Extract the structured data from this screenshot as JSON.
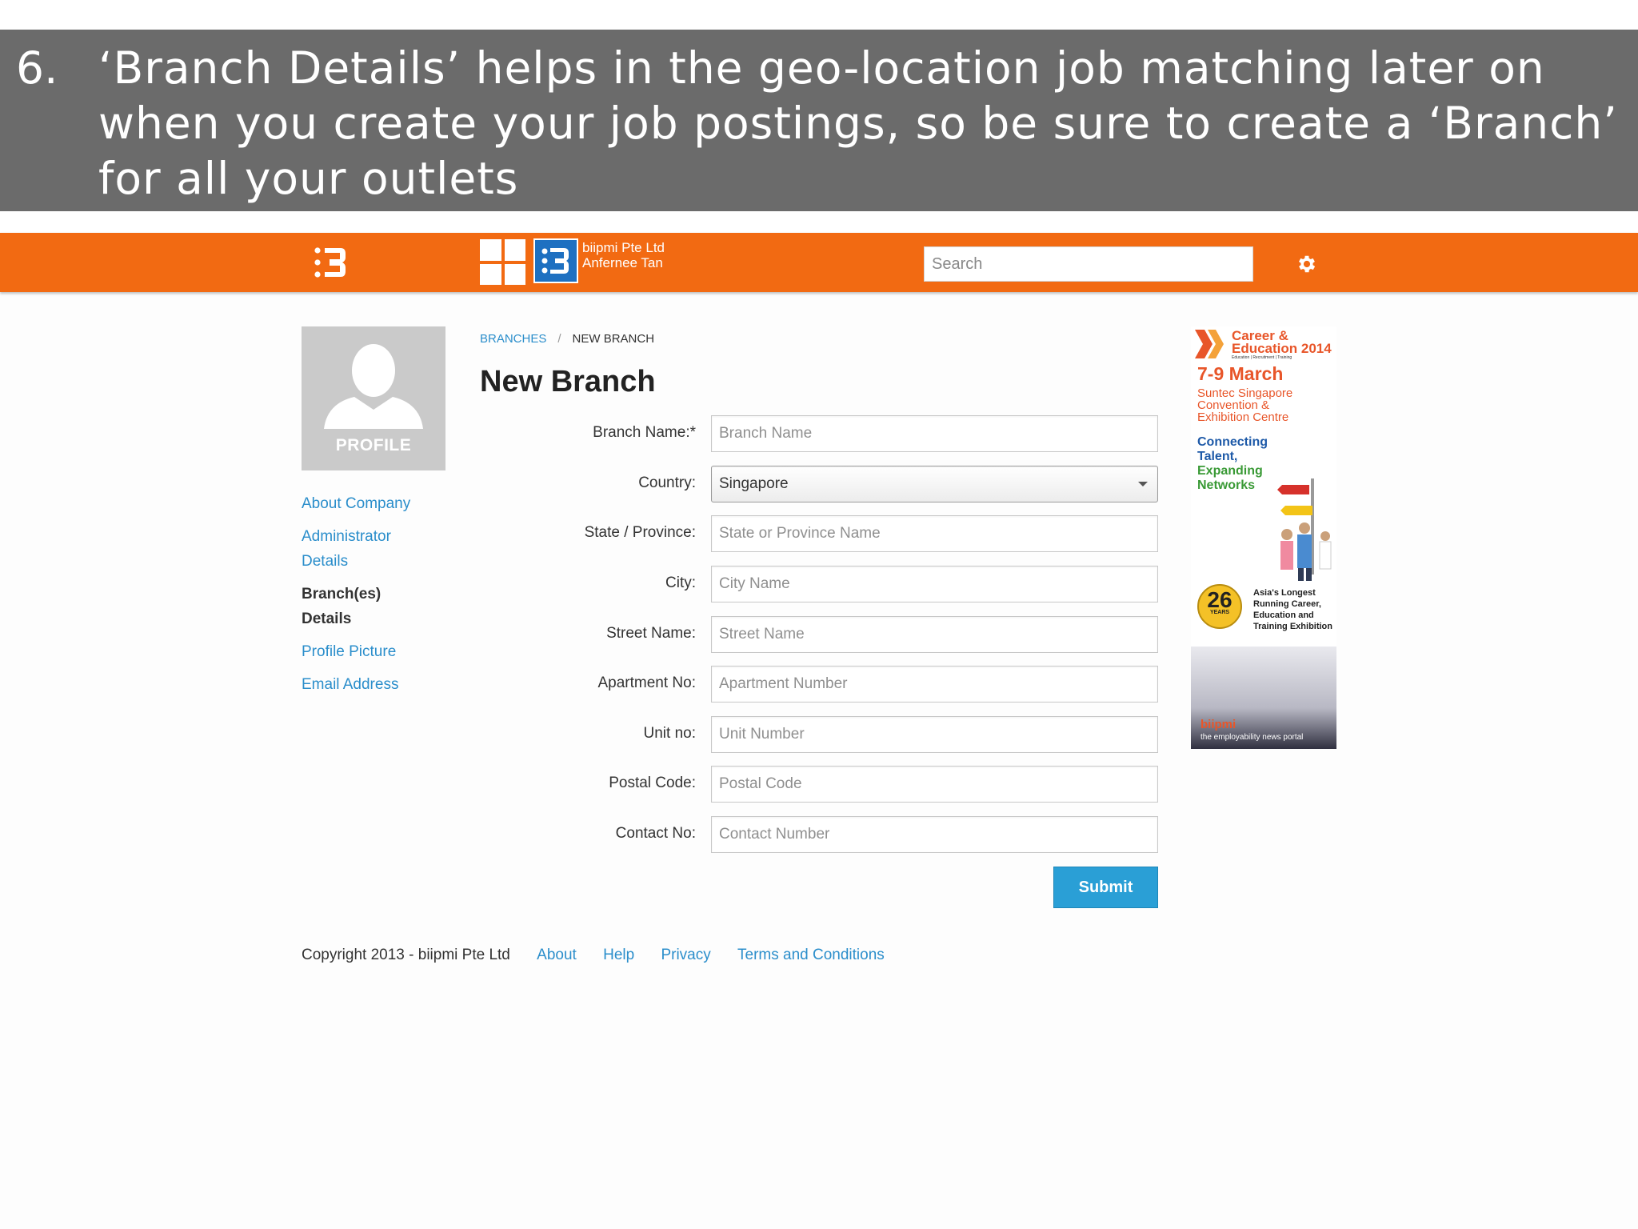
{
  "slide": {
    "number": "6.",
    "text": "‘Branch Details’ helps in the geo-location job matching later on when you create your job postings, so be sure to create a ‘Branch’ for all your outlets"
  },
  "header": {
    "company": "biipmi Pte Ltd",
    "user": "Anfernee Tan",
    "search_placeholder": "Search",
    "brand_color": "#f26a12"
  },
  "profile": {
    "label": "PROFILE"
  },
  "sidebar": {
    "items": [
      {
        "label": "About Company",
        "active": false
      },
      {
        "label": "Administrator Details",
        "active": false
      },
      {
        "label": "Branch(es) Details",
        "active": true
      },
      {
        "label": "Profile Picture",
        "active": false
      },
      {
        "label": "Email Address",
        "active": false
      }
    ]
  },
  "breadcrumb": {
    "parent": "BRANCHES",
    "separator": "/",
    "current": "NEW BRANCH"
  },
  "page_title": "New Branch",
  "form": {
    "branch_name": {
      "label": "Branch Name:*",
      "placeholder": "Branch Name"
    },
    "country": {
      "label": "Country:",
      "value": "Singapore"
    },
    "state": {
      "label": "State / Province:",
      "placeholder": "State or Province Name"
    },
    "city": {
      "label": "City:",
      "placeholder": "City Name"
    },
    "street": {
      "label": "Street Name:",
      "placeholder": "Street Name"
    },
    "apartment": {
      "label": "Apartment No:",
      "placeholder": "Apartment Number"
    },
    "unit": {
      "label": "Unit no:",
      "placeholder": "Unit Number"
    },
    "postal": {
      "label": "Postal Code:",
      "placeholder": "Postal Code"
    },
    "contact": {
      "label": "Contact No:",
      "placeholder": "Contact Number"
    },
    "submit_label": "Submit"
  },
  "footer": {
    "copyright": "Copyright 2013 - biipmi Pte Ltd",
    "links": [
      "About",
      "Help",
      "Privacy",
      "Terms and Conditions"
    ]
  },
  "ad": {
    "title_line1": "Career &",
    "title_line2": "Education 2014",
    "subtitle": "Education | Recruitment | Training",
    "date": "7-9 March",
    "venue_line1": "Suntec Singapore",
    "venue_line2": "Convention &",
    "venue_line3": "Exhibition Centre",
    "tag1": "Connecting",
    "tag2": "Talent,",
    "tag3": "Expanding",
    "tag4": "Networks",
    "years": "26",
    "years_label": "YEARS",
    "longest1": "Asia's Longest",
    "longest2": "Running Career,",
    "longest3": "Education and",
    "longest4": "Training Exhibition",
    "brand": "biipmi",
    "brand_tag": "the employability news portal"
  }
}
